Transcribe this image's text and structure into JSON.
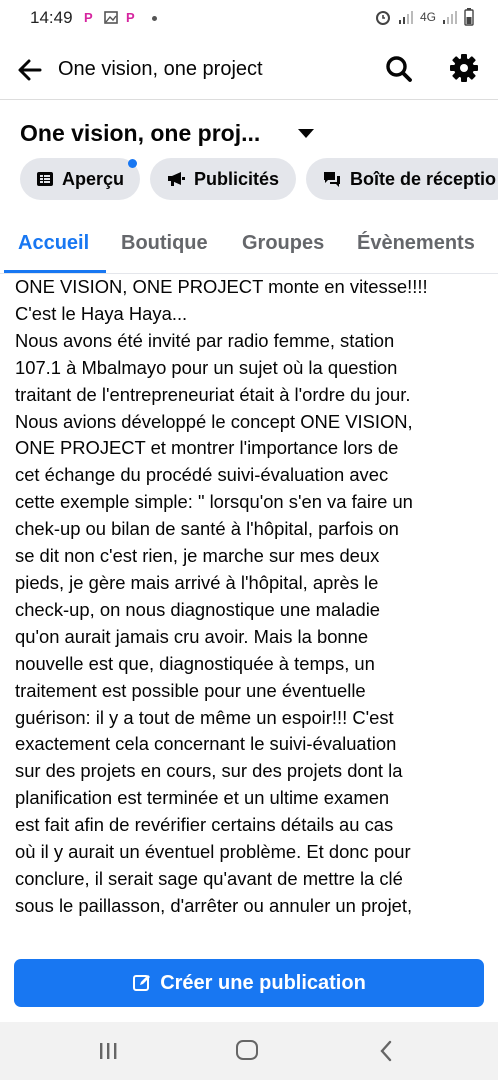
{
  "status_bar": {
    "time": "14:49",
    "notif_icons": [
      "p-icon",
      "image-icon",
      "p-icon"
    ],
    "network": "4G"
  },
  "header": {
    "title": "One vision, one project"
  },
  "page": {
    "name": "One vision, one proj..."
  },
  "chips": [
    {
      "label": "Aperçu",
      "icon": "overview-icon"
    },
    {
      "label": "Publicités",
      "icon": "megaphone-icon"
    },
    {
      "label": "Boîte de réceptio",
      "icon": "inbox-icon"
    }
  ],
  "tabs": [
    {
      "label": "Accueil",
      "active": true
    },
    {
      "label": "Boutique",
      "active": false
    },
    {
      "label": "Groupes",
      "active": false
    },
    {
      "label": "Évènements",
      "active": false
    }
  ],
  "post": {
    "lines": [
      "ONE VISION, ONE PROJECT monte en vitesse!!!!",
      "C'est le Haya Haya...",
      "Nous avons été invité par radio femme, station",
      "107.1 à Mbalmayo pour un sujet où la question",
      "traitant de l'entrepreneuriat était à l'ordre du jour.",
      "Nous avions développé le concept ONE VISION,",
      "ONE PROJECT et montrer l'importance lors de",
      "cet échange du procédé suivi-évaluation avec",
      "cette exemple simple: \" lorsqu'on s'en va faire un",
      "chek-up ou bilan de santé à l'hôpital, parfois on",
      "se dit non c'est rien, je marche sur mes deux",
      "pieds, je gère mais arrivé à l'hôpital, après le",
      "check-up, on nous diagnostique une maladie",
      "qu'on aurait jamais cru avoir. Mais la bonne",
      "nouvelle est que, diagnostiquée à temps,  un",
      "traitement est possible pour une éventuelle",
      "guérison: il y a tout de même un espoir!!! C'est",
      "exactement cela concernant le suivi-évaluation",
      "sur des projets en cours, sur des projets dont la",
      "planification est terminée et un ultime examen",
      "est fait afin de revérifier certains détails au cas",
      "où il y aurait un éventuel problème. Et donc pour",
      "conclure, il serait  sage qu'avant de mettre la clé",
      "sous le paillasson, d'arrêter ou annuler un projet,"
    ]
  },
  "create_button": {
    "label": "Créer une publication"
  },
  "colors": {
    "accent": "#1877f2",
    "chip_bg": "#e4e6eb",
    "text": "#050505",
    "muted": "#65676b"
  }
}
